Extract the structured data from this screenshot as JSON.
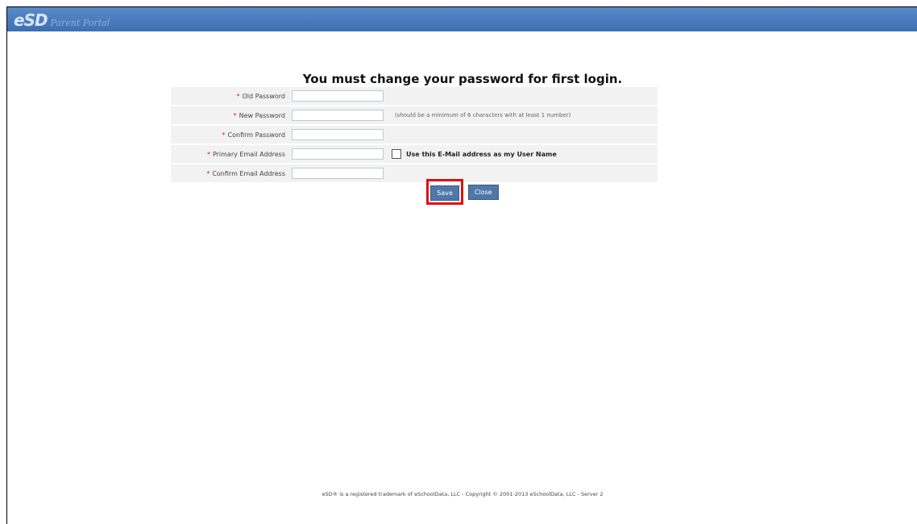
{
  "header": {
    "logo_mark": "eSD",
    "logo_text": "Parent Portal"
  },
  "page": {
    "title": "You must change your password for first login."
  },
  "form": {
    "required_marker": "*",
    "old_password_label": "Old Password",
    "new_password_label": "New Password",
    "new_password_hint": "(should be a minimum of 6 characters with at least 1 number)",
    "confirm_password_label": "Confirm Password",
    "primary_email_label": "Primary Email Address",
    "use_email_checkbox_label": "Use this E-Mail address as my User Name",
    "confirm_email_label": "Confirm Email Address",
    "old_password_value": "",
    "new_password_value": "",
    "confirm_password_value": "",
    "primary_email_value": "",
    "confirm_email_value": ""
  },
  "buttons": {
    "save_label": "Save",
    "close_label": "Close"
  },
  "footer": {
    "text": "eSD® is a registered trademark of eSchoolData, LLC - Copyright © 2001-2013 eSchoolData, LLC - Server 2"
  },
  "colors": {
    "header_bg": "#4a7cbf",
    "button_bg": "#4f78a8",
    "required": "#d62020",
    "highlight": "#e01010"
  }
}
